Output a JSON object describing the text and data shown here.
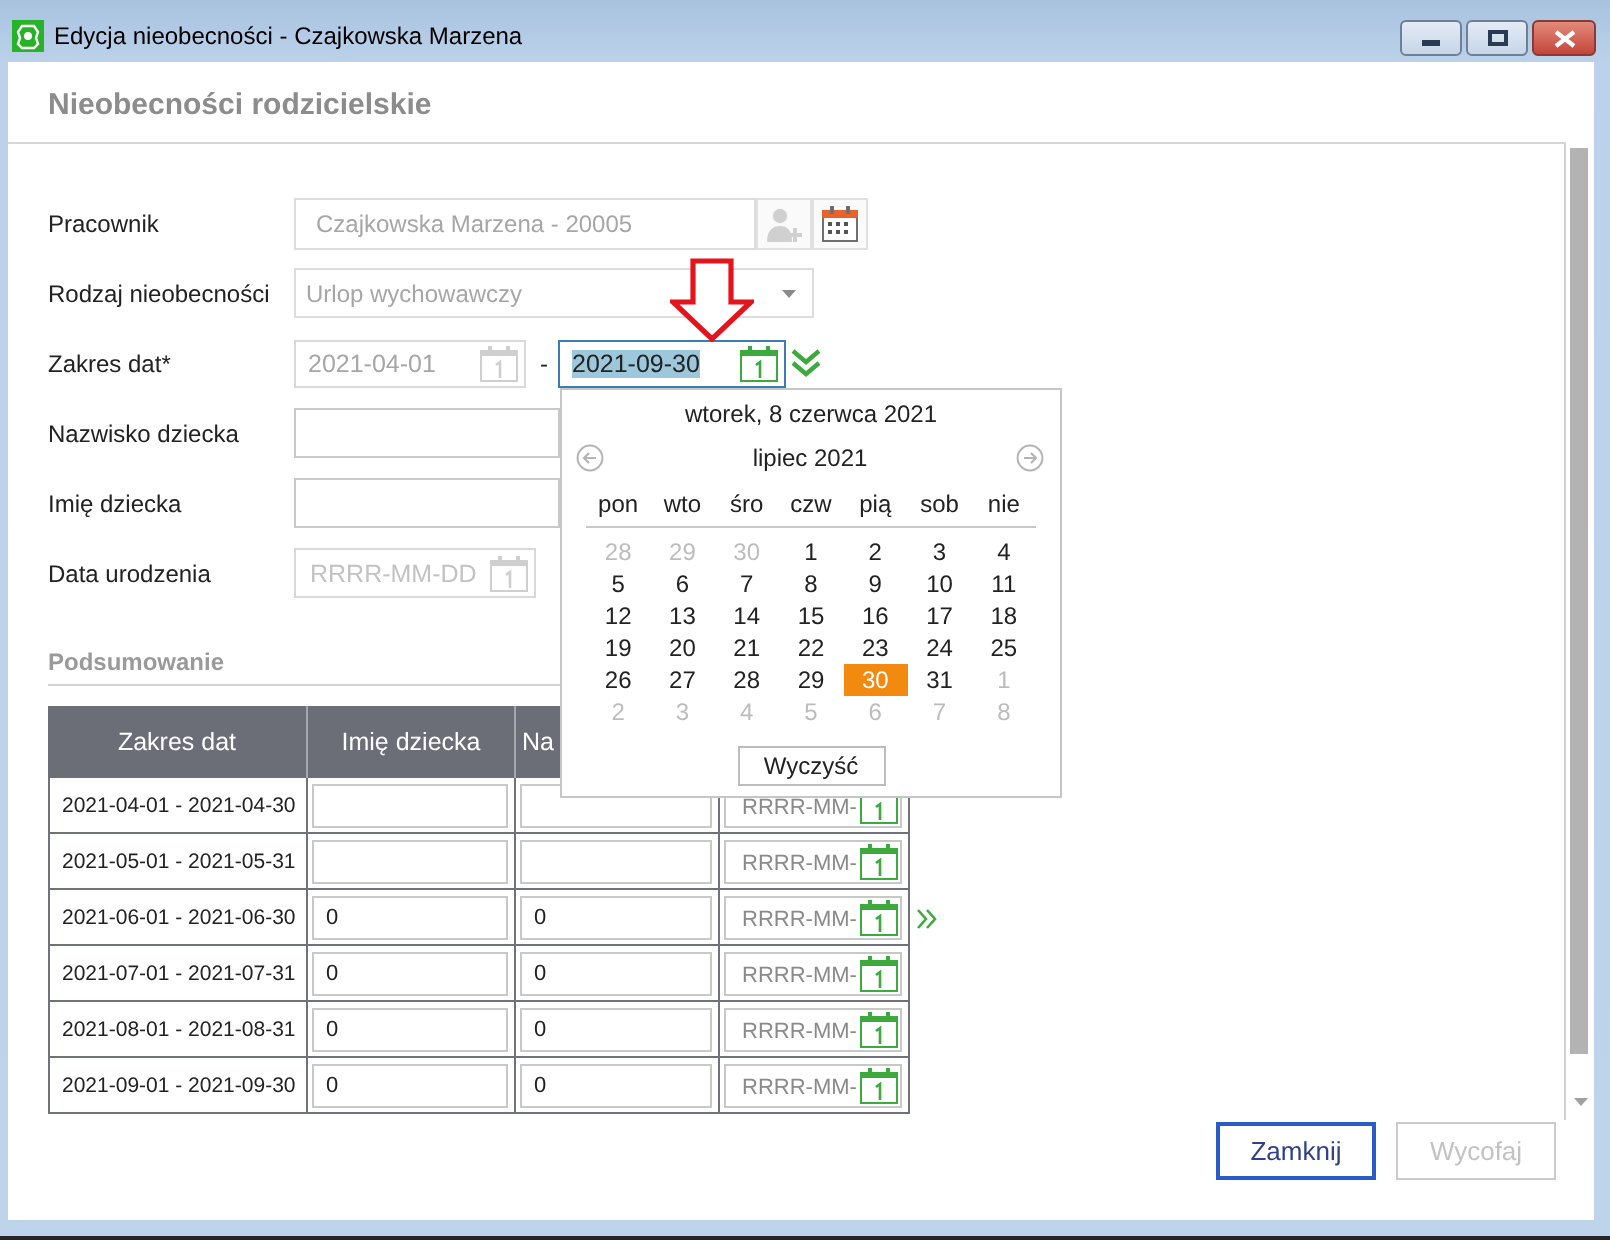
{
  "window": {
    "title": "Edycja nieobecności - Czajkowska Marzena"
  },
  "header": {
    "title": "Nieobecności rodzicielskie"
  },
  "form": {
    "fields": [
      {
        "kind": "employee",
        "label": "Pracownik",
        "value": "Czajkowska Marzena - 20005",
        "disabled": true
      },
      {
        "kind": "combo",
        "label": "Rodzaj nieobecności",
        "value": "Urlop wychowawczy",
        "disabled": true
      },
      {
        "kind": "range",
        "label": "Zakres dat*",
        "from": {
          "value": "2021-04-01",
          "disabled": true
        },
        "separator": "-",
        "to": {
          "value": "2021-09-30",
          "disabled": false,
          "focused": true,
          "text_selected": true
        }
      },
      {
        "kind": "text",
        "label": "Nazwisko dziecka",
        "disabled": false
      },
      {
        "kind": "text",
        "label": "Imię dziecka",
        "disabled": false
      },
      {
        "kind": "date",
        "label": "Data urodzenia",
        "placeholder": "RRRR-MM-DD",
        "disabled": true
      }
    ]
  },
  "date_picker": {
    "open": true,
    "today": "wtorek, 8 czerwca 2021",
    "month": "lipiec 2021",
    "weekdays": [
      "pon",
      "wto",
      "śro",
      "czw",
      "pią",
      "sob",
      "nie"
    ],
    "weeks": [
      [
        {
          "day": "28",
          "outside": true,
          "selected": false
        },
        {
          "day": "29",
          "outside": true,
          "selected": false
        },
        {
          "day": "30",
          "outside": true,
          "selected": false
        },
        {
          "day": "1",
          "outside": false,
          "selected": false
        },
        {
          "day": "2",
          "outside": false,
          "selected": false
        },
        {
          "day": "3",
          "outside": false,
          "selected": false
        },
        {
          "day": "4",
          "outside": false,
          "selected": false
        }
      ],
      [
        {
          "day": "5",
          "outside": false,
          "selected": false
        },
        {
          "day": "6",
          "outside": false,
          "selected": false
        },
        {
          "day": "7",
          "outside": false,
          "selected": false
        },
        {
          "day": "8",
          "outside": false,
          "selected": false
        },
        {
          "day": "9",
          "outside": false,
          "selected": false
        },
        {
          "day": "10",
          "outside": false,
          "selected": false
        },
        {
          "day": "11",
          "outside": false,
          "selected": false
        }
      ],
      [
        {
          "day": "12",
          "outside": false,
          "selected": false
        },
        {
          "day": "13",
          "outside": false,
          "selected": false
        },
        {
          "day": "14",
          "outside": false,
          "selected": false
        },
        {
          "day": "15",
          "outside": false,
          "selected": false
        },
        {
          "day": "16",
          "outside": false,
          "selected": false
        },
        {
          "day": "17",
          "outside": false,
          "selected": false
        },
        {
          "day": "18",
          "outside": false,
          "selected": false
        }
      ],
      [
        {
          "day": "19",
          "outside": false,
          "selected": false
        },
        {
          "day": "20",
          "outside": false,
          "selected": false
        },
        {
          "day": "21",
          "outside": false,
          "selected": false
        },
        {
          "day": "22",
          "outside": false,
          "selected": false
        },
        {
          "day": "23",
          "outside": false,
          "selected": false
        },
        {
          "day": "24",
          "outside": false,
          "selected": false
        },
        {
          "day": "25",
          "outside": false,
          "selected": false
        }
      ],
      [
        {
          "day": "26",
          "outside": false,
          "selected": false
        },
        {
          "day": "27",
          "outside": false,
          "selected": false
        },
        {
          "day": "28",
          "outside": false,
          "selected": false
        },
        {
          "day": "29",
          "outside": false,
          "selected": false
        },
        {
          "day": "30",
          "outside": false,
          "selected": true
        },
        {
          "day": "31",
          "outside": false,
          "selected": false
        },
        {
          "day": "1",
          "outside": true,
          "selected": false
        }
      ],
      [
        {
          "day": "2",
          "outside": true,
          "selected": false
        },
        {
          "day": "3",
          "outside": true,
          "selected": false
        },
        {
          "day": "4",
          "outside": true,
          "selected": false
        },
        {
          "day": "5",
          "outside": true,
          "selected": false
        },
        {
          "day": "6",
          "outside": true,
          "selected": false
        },
        {
          "day": "7",
          "outside": true,
          "selected": false
        },
        {
          "day": "8",
          "outside": true,
          "selected": false
        }
      ]
    ],
    "clear_button": "Wyczyść"
  },
  "summary": {
    "title": "Podsumowanie",
    "columns": [
      "Zakres dat",
      "Imię dziecka",
      "Na"
    ],
    "rows": [
      {
        "date_range": "2021-04-01 - 2021-04-30",
        "column_4": {
          "placeholder": "RRRR-MM-"
        },
        "marked": false
      },
      {
        "date_range": "2021-05-01 - 2021-05-31",
        "column_4": {
          "placeholder": "RRRR-MM-"
        },
        "marked": false
      },
      {
        "date_range": "2021-06-01 - 2021-06-30",
        "child_name": "0",
        "column_3": "0",
        "column_4": {
          "placeholder": "RRRR-MM-"
        },
        "marked": true
      },
      {
        "date_range": "2021-07-01 - 2021-07-31",
        "child_name": "0",
        "column_3": "0",
        "column_4": {
          "placeholder": "RRRR-MM-"
        },
        "marked": false
      },
      {
        "date_range": "2021-08-01 - 2021-08-31",
        "child_name": "0",
        "column_3": "0",
        "column_4": {
          "placeholder": "RRRR-MM-"
        },
        "marked": false
      },
      {
        "date_range": "2021-09-01 - 2021-09-30",
        "child_name": "0",
        "column_3": "0",
        "column_4": {
          "placeholder": "RRRR-MM-"
        },
        "marked": false
      }
    ]
  },
  "buttons": [
    {
      "label": "Zamknij",
      "default": true,
      "disabled": false
    },
    {
      "label": "Wycofaj",
      "default": false,
      "disabled": true
    }
  ]
}
